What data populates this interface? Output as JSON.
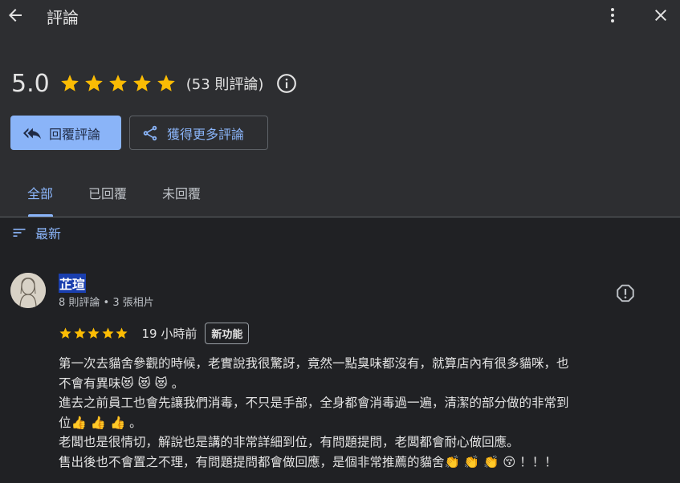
{
  "header": {
    "title": "評論"
  },
  "summary": {
    "score": "5.0",
    "stars": 5,
    "count": "(53 則評論)"
  },
  "actions": {
    "reply_label": "回覆評論",
    "more_label": "獲得更多評論"
  },
  "tabs": [
    {
      "label": "全部",
      "active": true
    },
    {
      "label": "已回覆",
      "active": false
    },
    {
      "label": "未回覆",
      "active": false
    }
  ],
  "sort": {
    "label": "最新"
  },
  "review": {
    "name": "芷瑄",
    "meta": "8 則評論 • 3 張相片",
    "stars": 5,
    "time": "19 小時前",
    "badge": "新功能",
    "lines": [
      "第一次去貓舍參觀的時候，老實說我很驚訝，竟然一點臭味都沒有，就算店內有很多貓咪，也",
      "不會有異味😻 😻 😻 。",
      "進去之前員工也會先讓我們消毒，不只是手部，全身都會消毒過一遍，清潔的部分做的非常到",
      "位👍 👍 👍 。",
      "老闆也是很情切，解說也是講的非常詳細到位，有問題提問，老闆都會耐心做回應。",
      "售出後也不會置之不理，有問題提問都會做回應，是個非常推薦的貓舍👏 👏 👏 😚 ！！！"
    ]
  },
  "colors": {
    "background": "#2d2e31",
    "content_bg": "#202124",
    "accent": "#8ab4f8",
    "star": "#fbbc04",
    "text": "#e3e3e3"
  }
}
